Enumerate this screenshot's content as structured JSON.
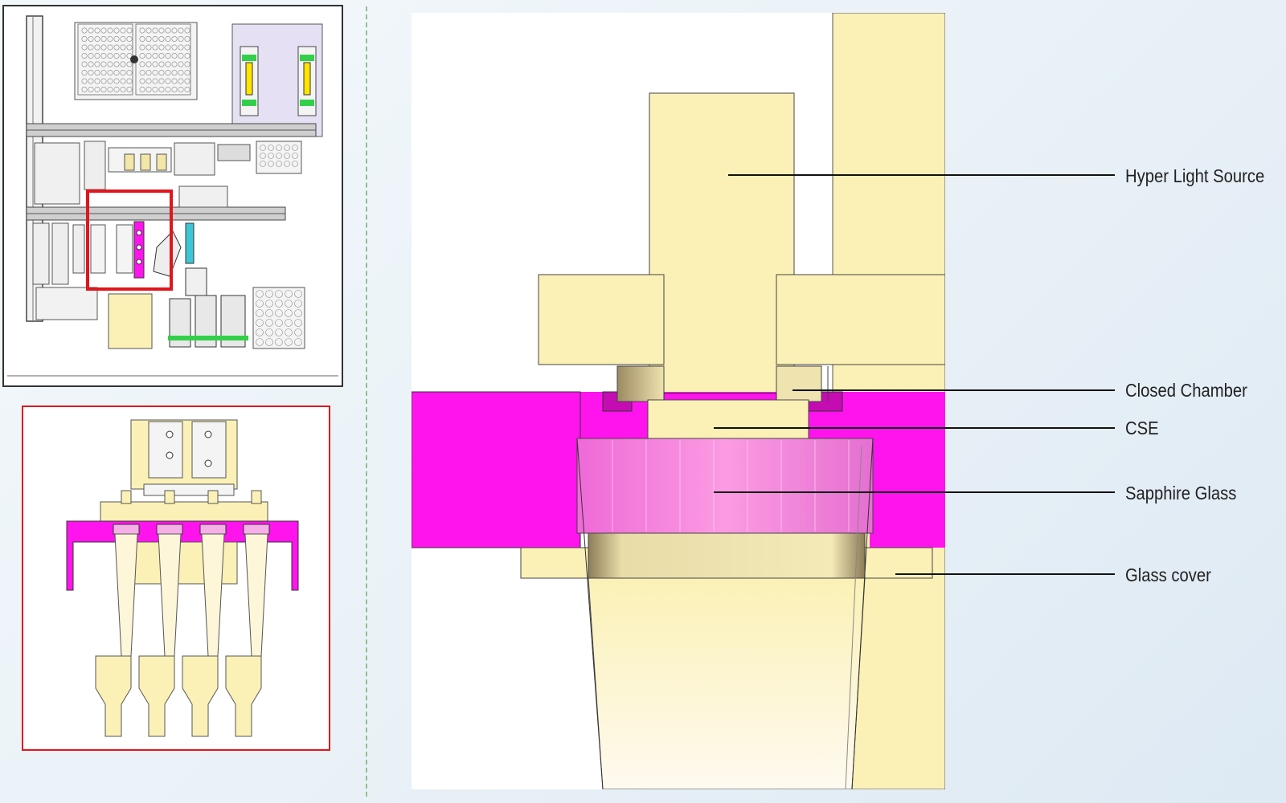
{
  "callouts": [
    {
      "label": "Hyper Light Source"
    },
    {
      "label": "Closed Chamber"
    },
    {
      "label": "CSE"
    },
    {
      "label": "Sapphire Glass"
    },
    {
      "label": "Glass cover"
    }
  ],
  "colors": {
    "beige": "#fbf1b6",
    "magenta": "#ff14ee",
    "sapphire": "#f28bd9",
    "highlight_box": "#e0161d",
    "divider": "#8dc48d"
  }
}
